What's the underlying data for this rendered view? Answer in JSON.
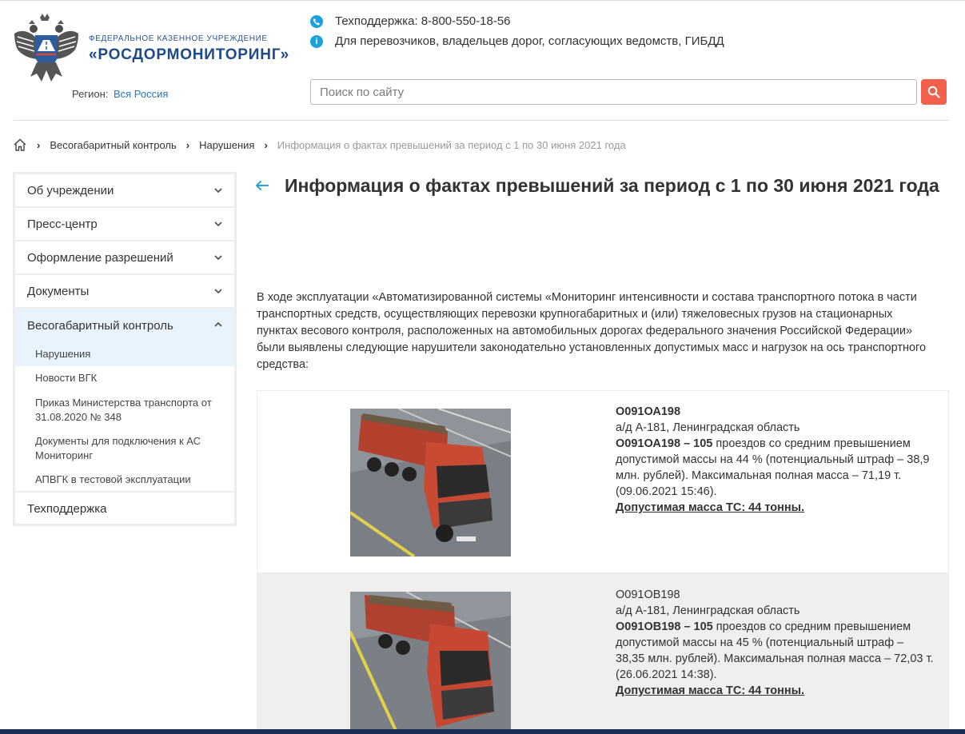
{
  "header": {
    "org_small": "Федеральное казенное учреждение",
    "org_big": "«РОСДОРМОНИТОРИНГ»",
    "region_label": "Регион:",
    "region_value": "Вся Россия",
    "support": "Техподдержка: 8-800-550-18-56",
    "info_text": "Для перевозчиков, владельцев дорог, согласующих ведомств, ГИБДД",
    "search_placeholder": "Поиск по сайту"
  },
  "breadcrumbs": {
    "items": [
      "Весогабаритный контроль",
      "Нарушения"
    ],
    "current": "Информация о фактах превышений за период с 1 по 30 июня 2021 года"
  },
  "sidebar": {
    "items": [
      {
        "label": "Об учреждении"
      },
      {
        "label": "Пресс-центр"
      },
      {
        "label": "Оформление разрешений"
      },
      {
        "label": "Документы"
      },
      {
        "label": "Весогабаритный контроль"
      }
    ],
    "sub_items": [
      {
        "label": "Нарушения"
      },
      {
        "label": "Новости ВГК"
      },
      {
        "label": "Приказ Министерства транспорта от 31.08.2020 № 348"
      },
      {
        "label": "Документы для подключения к АС Мониторинг"
      },
      {
        "label": "АПВГК в тестовой эксплуатации"
      }
    ],
    "last_item": "Техподдержка"
  },
  "main": {
    "title": "Информация о фактах превышений за период с 1 по 30 июня 2021 года",
    "intro": "В ходе эксплуатации «Автоматизированной системы «Мониторинг интенсивности и состава транспортного потока в части транспортных средств, осуществляющих перевозки крупногабаритных и (или) тяжеловесных грузов на стационарных пунктах весового контроля, расположенных на автомобильных дорогах федерального значения Российской Федерации» были выявлены следующие нарушители законодательно установленных допустимых масс и нагрузок на ось транспортного средства:",
    "violations": [
      {
        "plate": "О091ОА198",
        "road": "а/д А-181, Ленинградская область",
        "plate_count": "О091ОА198 – 105",
        "text": " проездов со средним превышением допустимой массы на 44 % (потенциальный штраф – 38,9 млн. рублей). Максимальная полная масса – 71,19 т. (09.06.2021 15:46).",
        "limit": "Допустимая масса ТС: 44 тонны."
      },
      {
        "plate": "О091ОВ198",
        "road": "а/д А-181, Ленинградская область",
        "plate_count": "О091ОВ198 – 105",
        "text": " проездов со средним превышением допустимой массы на 45 % (потенциальный штраф – 38,35 млн. рублей). Максимальная полная масса – 72,03 т. (26.06.2021 14:38).",
        "limit": "Допустимая масса ТС: 44 тонны."
      }
    ]
  },
  "colors": {
    "accent": "#1aa1e0",
    "search_button": "#f2604b",
    "brand": "#1e4a8a",
    "sidebar_active": "#e8f3fb"
  },
  "icons": [
    "emblem-icon",
    "phone-icon",
    "info-icon",
    "search-icon",
    "home-icon",
    "chevron-down-icon",
    "chevron-up-icon",
    "back-arrow-icon"
  ]
}
